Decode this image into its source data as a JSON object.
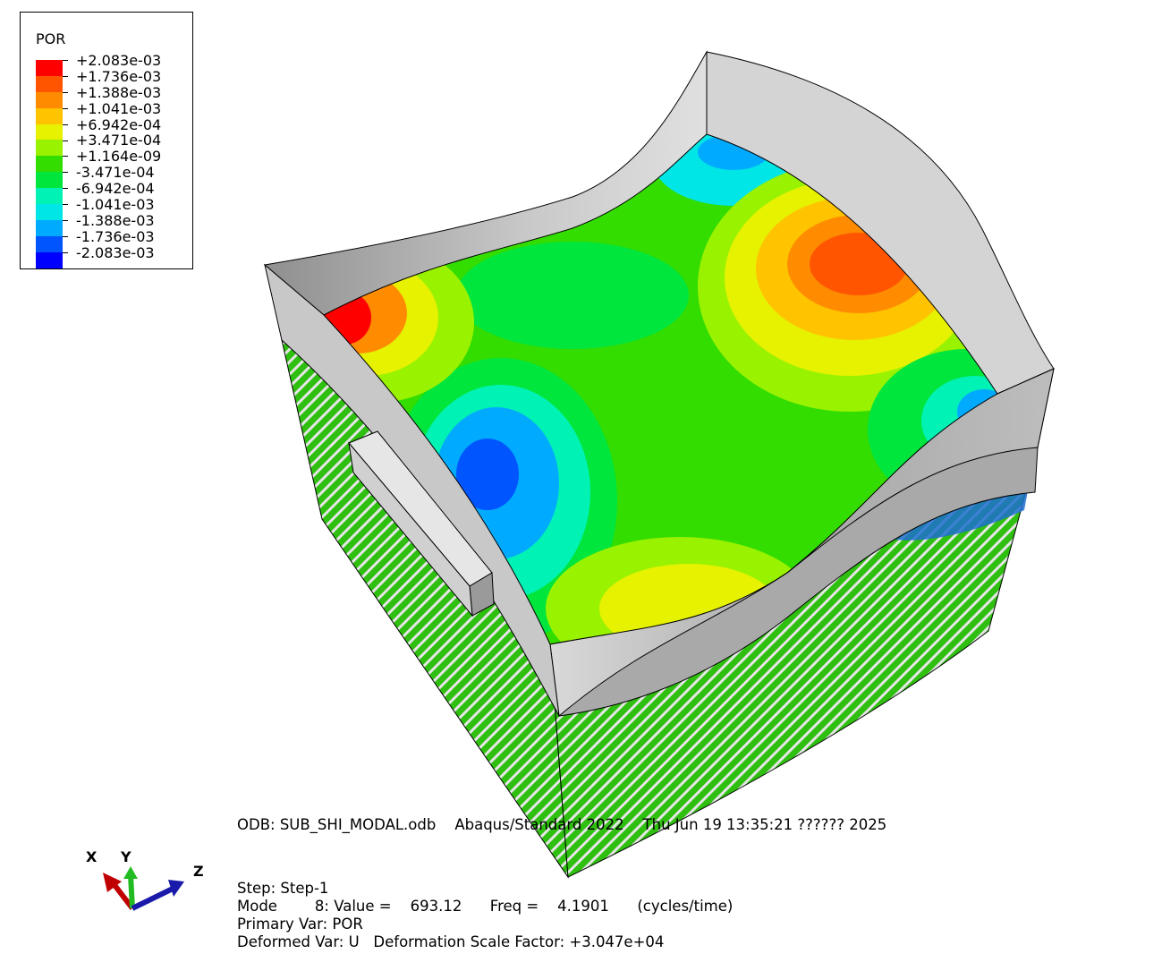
{
  "legend": {
    "title": "POR",
    "colors": [
      "#ff0000",
      "#ff5500",
      "#ff8c00",
      "#ffc300",
      "#e6f200",
      "#99f200",
      "#33dd00",
      "#00e63c",
      "#00f2b4",
      "#00e6e6",
      "#00aaff",
      "#0055ff",
      "#0000ff"
    ],
    "labels": [
      "+2.083e-03",
      "+1.736e-03",
      "+1.388e-03",
      "+1.041e-03",
      "+6.942e-04",
      "+3.471e-04",
      "+1.164e-09",
      "-3.471e-04",
      "-6.942e-04",
      "-1.041e-03",
      "-1.388e-03",
      "-1.736e-03",
      "-2.083e-03"
    ]
  },
  "info": {
    "odb_line": "ODB: SUB_SHI_MODAL.odb    Abaqus/Standard 2022    Thu Jun 19 13:35:21 ?????? 2025",
    "step_line": "Step: Step-1",
    "mode_line": "Mode        8: Value =    693.12      Freq =    4.1901      (cycles/time)",
    "primary_line": "Primary Var: POR",
    "deformed_line": "Deformed Var: U   Deformation Scale Factor: +3.047e+04"
  },
  "triad": {
    "x_label": "X",
    "y_label": "Y",
    "z_label": "Z"
  },
  "colors": {
    "x_axis": "#c00000",
    "y_axis": "#22bb22",
    "z_axis": "#1a1aaa"
  }
}
